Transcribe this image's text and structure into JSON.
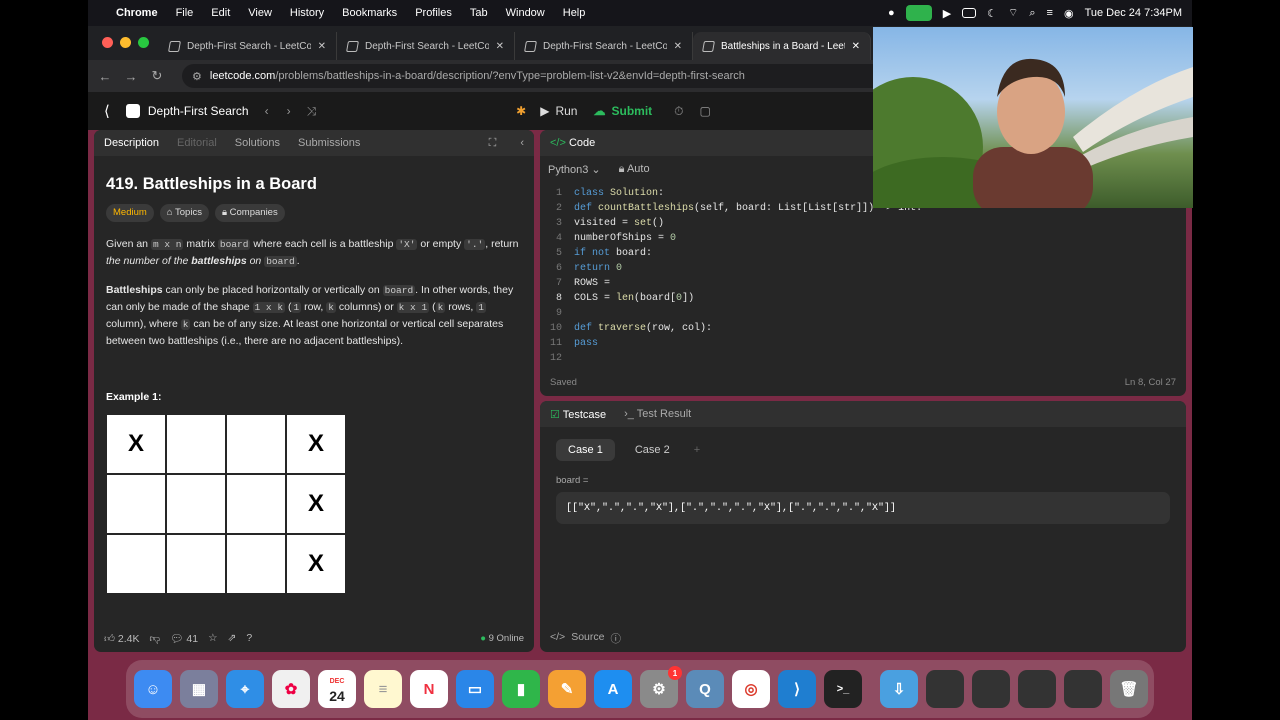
{
  "menubar": {
    "app": "Chrome",
    "items": [
      "File",
      "Edit",
      "View",
      "History",
      "Bookmarks",
      "Profiles",
      "Tab",
      "Window",
      "Help"
    ],
    "clock": "Tue Dec 24  7:34PM"
  },
  "browser": {
    "tabs": [
      "Depth-First Search - LeetCod",
      "Depth-First Search - LeetCod",
      "Depth-First Search - LeetCod",
      "Battleships in a Board - LeetC"
    ],
    "url_host": "leetcode.com",
    "url_path": "/problems/battleships-in-a-board/description/?envType=problem-list-v2&envId=depth-first-search"
  },
  "leetcode": {
    "list_title": "Depth-First Search",
    "run": "Run",
    "submit": "Submit"
  },
  "description": {
    "tabs": [
      "Description",
      "Editorial",
      "Solutions",
      "Submissions"
    ],
    "title": "419. Battleships in a Board",
    "tags": [
      "Medium",
      "Topics",
      "Companies"
    ],
    "example_label": "Example 1:",
    "board": [
      [
        "X",
        "",
        "",
        "X"
      ],
      [
        "",
        "",
        "",
        "X"
      ],
      [
        "",
        "",
        "",
        "X"
      ]
    ],
    "likes": "2.4K",
    "comments": "41",
    "online": "9 Online"
  },
  "code": {
    "header": "Code",
    "language": "Python3",
    "mode": "Auto",
    "saved": "Saved",
    "cursor": "Ln 8, Col 27",
    "line_numbers": [
      "1",
      "2",
      "3",
      "4",
      "5",
      "6",
      "7",
      "8",
      "9",
      "10",
      "11",
      "12"
    ]
  },
  "testcase": {
    "tabs": [
      "Testcase",
      "Test Result"
    ],
    "cases": [
      "Case 1",
      "Case 2"
    ],
    "var_label": "board =",
    "value": "[[\"X\",\".\",\".\",\"X\"],[\".\",\".\",\".\",\"X\"],[\".\",\".\",\".\",\"X\"]]",
    "source": "Source"
  },
  "dock": {
    "calendar_month": "DEC",
    "calendar_day": "24",
    "badge": "1"
  }
}
